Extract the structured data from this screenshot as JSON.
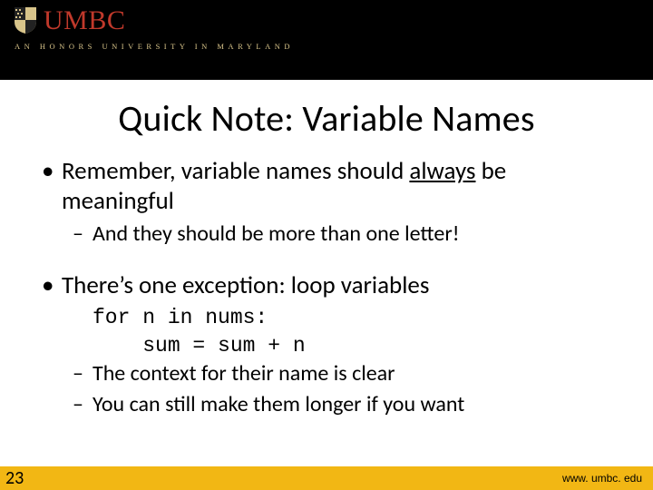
{
  "header": {
    "wordmark": "UMBC",
    "tagline": "AN HONORS UNIVERSITY IN MARYLAND"
  },
  "title": "Quick Note: Variable Names",
  "bullets": {
    "b1a_pre": "Remember, variable names should ",
    "b1a_u": "always",
    "b1a_post": " be meaningful",
    "b2a": "And they should be more than one letter!",
    "b1b": "There’s one exception: loop variables",
    "code1": "for n in nums:",
    "code2": "    sum = sum + n",
    "b2b": "The context for their name is clear",
    "b2c": "You can still make them longer if you want"
  },
  "footer": {
    "slidenum": "23",
    "url": "www. umbc. edu"
  }
}
